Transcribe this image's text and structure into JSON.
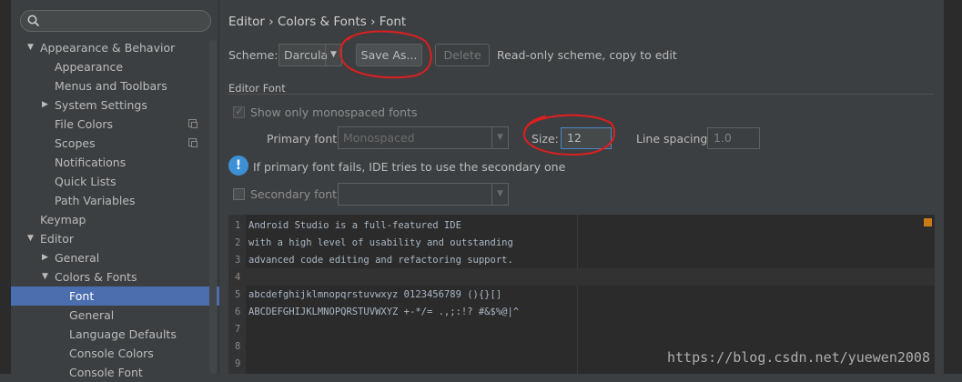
{
  "sidebar": {
    "search_placeholder": "",
    "items": [
      {
        "label": "Appearance & Behavior",
        "arrow": "▼"
      },
      {
        "label": "Appearance"
      },
      {
        "label": "Menus and Toolbars"
      },
      {
        "label": "System Settings",
        "arrow": "▶"
      },
      {
        "label": "File Colors"
      },
      {
        "label": "Scopes"
      },
      {
        "label": "Notifications"
      },
      {
        "label": "Quick Lists"
      },
      {
        "label": "Path Variables"
      },
      {
        "label": "Keymap"
      },
      {
        "label": "Editor",
        "arrow": "▼"
      },
      {
        "label": "General",
        "arrow": "▶"
      },
      {
        "label": "Colors & Fonts",
        "arrow": "▼"
      },
      {
        "label": "Font"
      },
      {
        "label": "General"
      },
      {
        "label": "Language Defaults"
      },
      {
        "label": "Console Colors"
      },
      {
        "label": "Console Font"
      }
    ]
  },
  "breadcrumb": {
    "part1": "Editor",
    "part2": "Colors & Fonts",
    "part3": "Font",
    "sep": "›"
  },
  "scheme": {
    "label": "Scheme:",
    "value": "Darcula",
    "save_as_label": "Save As...",
    "delete_label": "Delete",
    "readonly_text": "Read-only scheme, copy to edit"
  },
  "editor_font": {
    "section_title": "Editor Font",
    "show_mono_label": "Show only monospaced fonts",
    "primary_font_label": "Primary font:",
    "primary_font_value": "Monospaced",
    "size_label": "Size:",
    "size_value": "12",
    "line_spacing_label": "Line spacing:",
    "line_spacing_value": "1.0",
    "info_text": "If primary font fails, IDE tries to use the secondary one",
    "secondary_font_label": "Secondary font:"
  },
  "preview": {
    "lines": [
      {
        "num": "1",
        "text": "Android Studio is a full-featured IDE"
      },
      {
        "num": "2",
        "text": "with a high level of usability and outstanding"
      },
      {
        "num": "3",
        "text": "advanced code editing and refactoring support."
      },
      {
        "num": "4",
        "text": ""
      },
      {
        "num": "5",
        "text": "abcdefghijklmnopqrstuvwxyz 0123456789 (){}[]"
      },
      {
        "num": "6",
        "text": "ABCDEFGHIJKLMNOPQRSTUVWXYZ +-*/= .,;:!? #&$%@|^"
      },
      {
        "num": "7",
        "text": ""
      },
      {
        "num": "8",
        "text": ""
      },
      {
        "num": "9",
        "text": ""
      }
    ]
  },
  "watermark": "https://blog.csdn.net/yuewen2008",
  "colors": {
    "selection": "#4b6eaf",
    "annotation": "#e01e1e",
    "accent": "#3d8fd6"
  }
}
